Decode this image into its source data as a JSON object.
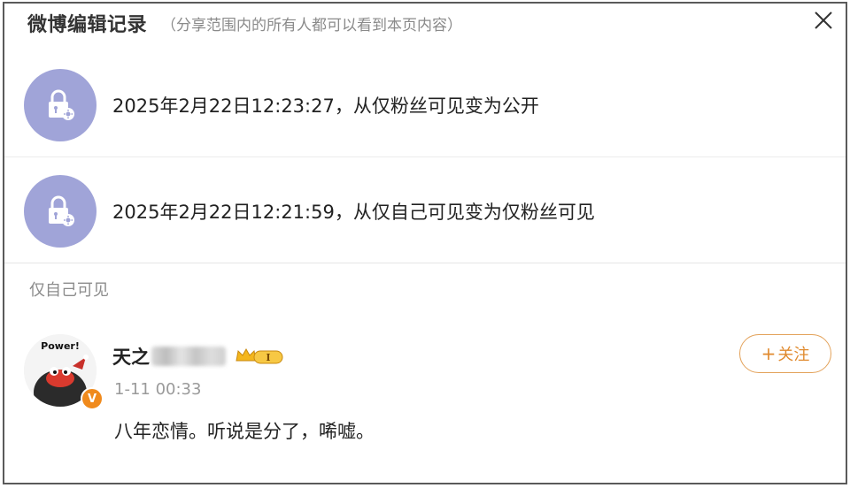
{
  "header": {
    "title": "微博编辑记录",
    "subtitle": "（分享范围内的所有人都可以看到本页内容）"
  },
  "records": [
    {
      "icon": "lock-gear-icon",
      "text": "2025年2月22日12:23:27，从仅粉丝可见变为公开"
    },
    {
      "icon": "lock-gear-icon",
      "text": "2025年2月22日12:21:59，从仅自己可见变为仅粉丝可见"
    }
  ],
  "visibility_label": "仅自己可见",
  "post": {
    "avatar_caption": "Power!",
    "verified_badge": "V",
    "user_name_visible": "天之",
    "vip_level": "I",
    "time": "1-11 00:33",
    "content": "八年恋情。听说是分了，唏嘘。",
    "follow_label": "关注",
    "follow_plus": "+"
  },
  "colors": {
    "lock_circle": "#a0a4d8",
    "follow_accent": "#e08a2e",
    "verified_badge": "#f08a1c"
  }
}
